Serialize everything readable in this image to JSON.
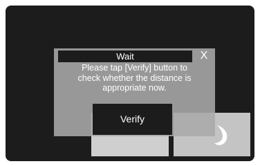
{
  "dialog": {
    "title": "Wait",
    "close_label": "X",
    "message_lines": [
      "Please tap [Verify] button to",
      "check whether the distance is",
      "appropriate now."
    ],
    "verify_label": "Verify"
  },
  "background": {
    "tile_right_icon": "swirl-icon"
  },
  "colors": {
    "screen_bg": "#1c1c1c",
    "dialog_bg": "#aaaaaa",
    "tile_bg": "#c8c8c8",
    "text": "#ffffff"
  }
}
